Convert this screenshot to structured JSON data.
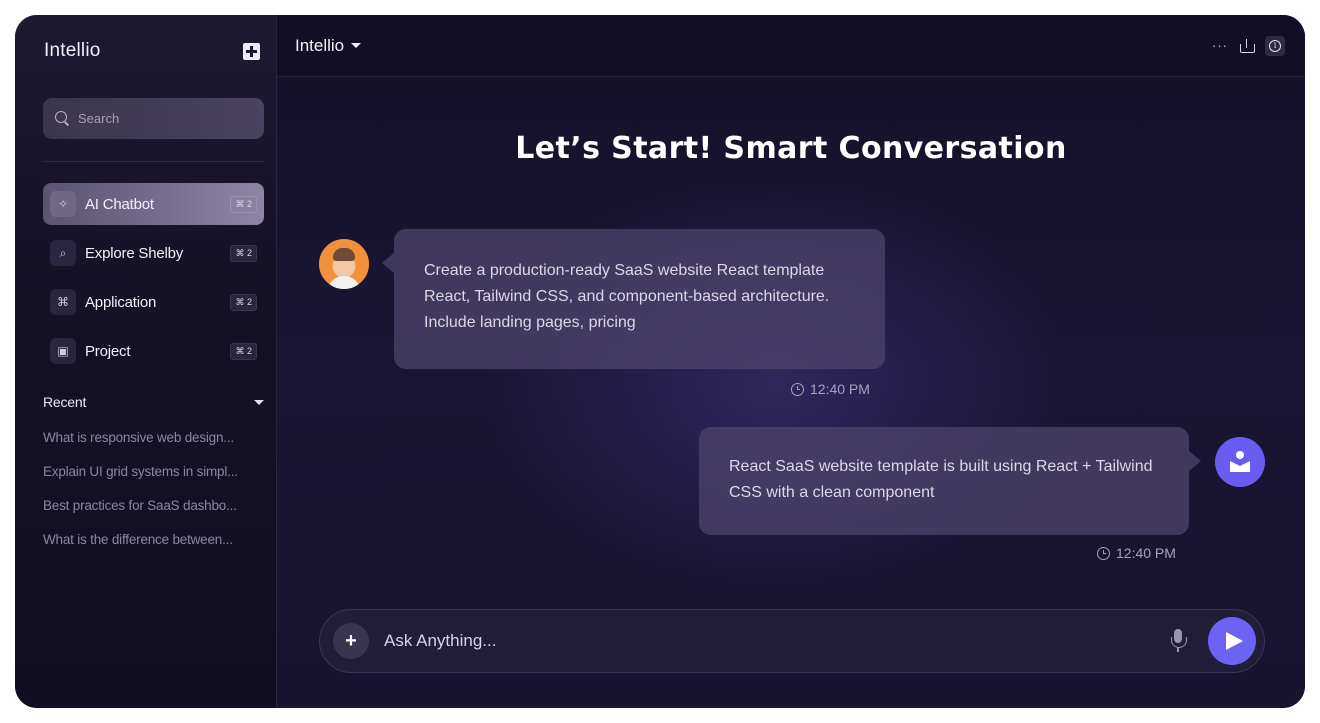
{
  "sidebar": {
    "brand": "Intellio",
    "search_placeholder": "Search",
    "nav": [
      {
        "label": "AI Chatbot",
        "shortcut": "⌘ 2",
        "icon": "sparkle-icon",
        "active": true
      },
      {
        "label": "Explore Shelby",
        "shortcut": "⌘ 2",
        "icon": "search-icon",
        "active": false
      },
      {
        "label": "Application",
        "shortcut": "⌘ 2",
        "icon": "command-icon",
        "active": false
      },
      {
        "label": "Project",
        "shortcut": "⌘ 2",
        "icon": "file-icon",
        "active": false
      }
    ],
    "recent_title": "Recent",
    "recent": [
      "What is responsive web design...",
      "Explain UI grid systems in simpl...",
      "Best practices for SaaS dashbo...",
      "What is the difference between..."
    ]
  },
  "header": {
    "model": "Intellio",
    "more": "···"
  },
  "main": {
    "heading": "Let’s Start! Smart Conversation"
  },
  "messages": [
    {
      "role": "user",
      "text": "Create a production-ready SaaS website React template React, Tailwind CSS, and component-based architecture. Include landing pages, pricing",
      "time": "12:40 PM"
    },
    {
      "role": "assistant",
      "text": "React SaaS website template is built using React + Tailwind CSS with a clean component",
      "time": "12:40 PM"
    }
  ],
  "composer": {
    "placeholder": "Ask Anything...",
    "plus": "+"
  },
  "colors": {
    "accent": "#6c63f4",
    "background": "#14102a",
    "user_avatar": "#f2913c"
  }
}
